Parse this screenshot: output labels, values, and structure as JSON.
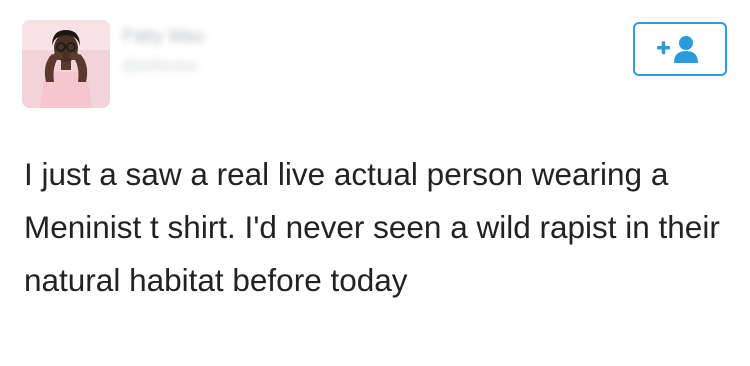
{
  "tweet": {
    "author": {
      "display_name": "Patty Wao",
      "handle": "@pattywao",
      "avatar": "profile-photo"
    },
    "follow_button": {
      "icon": "add-user-icon",
      "label": "+",
      "accent_color": "#2b9bdb"
    },
    "text": "I just a saw a real live actual person wearing a Meninist t shirt. I'd never seen a wild rapist in their natural habitat before today"
  }
}
